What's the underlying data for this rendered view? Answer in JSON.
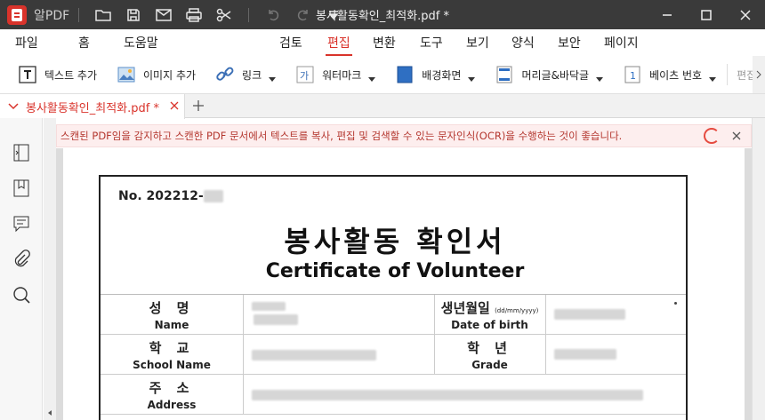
{
  "titlebar": {
    "app_name": "알PDF",
    "doc_title": "봉사활동확인_최적화.pdf *"
  },
  "menu": {
    "left": [
      "파일",
      "홈",
      "도움말"
    ],
    "right": [
      "검토",
      "편집",
      "변환",
      "도구",
      "보기",
      "양식",
      "보안",
      "페이지"
    ],
    "active": "편집"
  },
  "toolbar": {
    "text_add": "텍스트 추가",
    "image_add": "이미지 추가",
    "link": "링크",
    "watermark": "워터마크",
    "background": "배경화면",
    "header_footer": "머리글&바닥글",
    "bates": "베이츠 번호",
    "edit_more": "편집"
  },
  "tabs": {
    "active_label": "봉사활동확인_최적화.pdf *"
  },
  "ocr": {
    "message": "스캔된 PDF임을 감지하고 스캔한 PDF 문서에서 텍스트를 복사, 편집 및 검색할 수 있는 문자인식(OCR)을 수행하는 것이 좋습니다."
  },
  "certificate": {
    "number_prefix": "No. 202212-",
    "title_ko": "봉사활동 확인서",
    "title_en": "Certificate of Volunteer",
    "rows": [
      {
        "label_ko": "성 명",
        "label_en": "Name",
        "label2_ko": "생년월일",
        "label2_sub": "(dd/mm/yyyy)",
        "label2_en": "Date of birth"
      },
      {
        "label_ko": "학 교",
        "label_en": "School Name",
        "label2_ko": "학 년",
        "label2_en": "Grade"
      },
      {
        "label_ko": "주 소",
        "label_en": "Address"
      }
    ]
  },
  "colors": {
    "accent": "#d9332b",
    "titlebar": "#3a3a3a",
    "ocr_bg": "#fdeeee"
  }
}
